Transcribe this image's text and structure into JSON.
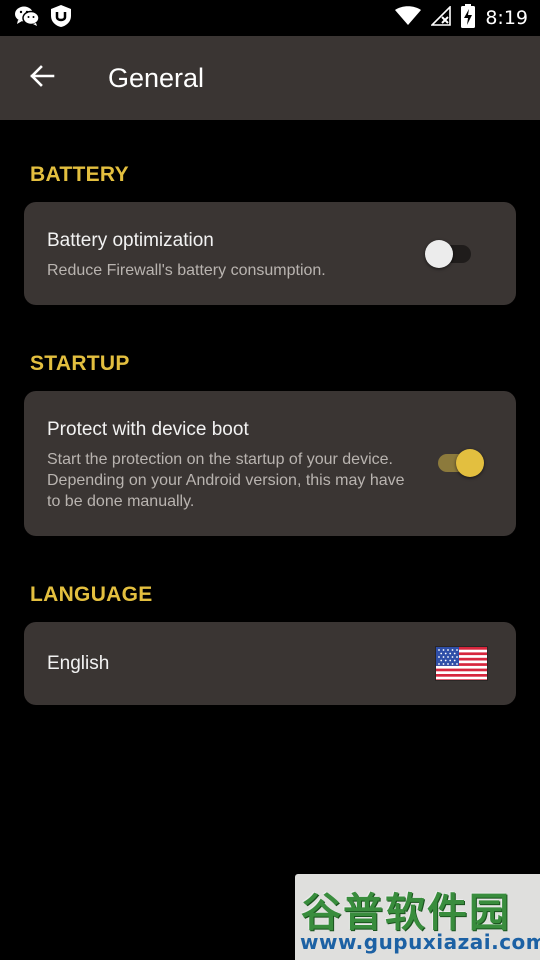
{
  "status_bar": {
    "time": "8:19",
    "left_icons": [
      "wechat-icon",
      "shield-app-icon"
    ],
    "right_icons": [
      "wifi-icon",
      "no-sim-icon",
      "battery-charging-icon"
    ]
  },
  "app_bar": {
    "title": "General",
    "back_icon": "arrow-back-icon"
  },
  "colors": {
    "accent": "#e3bf3f",
    "card_bg": "#3a3533",
    "background": "#000000"
  },
  "sections": {
    "battery": {
      "header": "BATTERY",
      "title": "Battery optimization",
      "subtitle": "Reduce Firewall's battery consumption.",
      "toggle_on": false
    },
    "startup": {
      "header": "STARTUP",
      "title": "Protect with device boot",
      "subtitle": "Start the protection on the startup of your device. Depending on your Android version, this may have to be done manually.",
      "toggle_on": true
    },
    "language": {
      "header": "LANGUAGE",
      "value": "English",
      "flag_icon": "us-flag-icon"
    }
  },
  "watermark": {
    "brand": "谷普软件园",
    "url": "www.gupuxiazai.com"
  }
}
